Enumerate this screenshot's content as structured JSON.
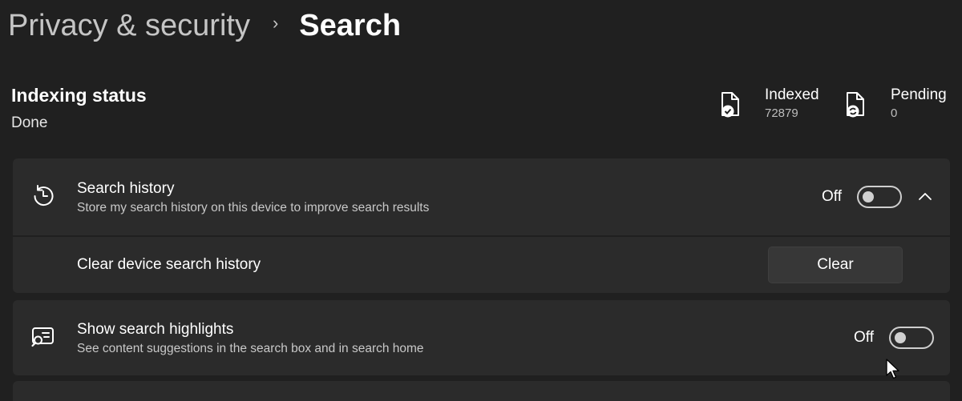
{
  "breadcrumb": {
    "parent": "Privacy & security",
    "separator": "›",
    "current": "Search"
  },
  "indexing": {
    "title": "Indexing status",
    "status": "Done",
    "indexed": {
      "label": "Indexed",
      "value": "72879",
      "icon": "file-check-icon"
    },
    "pending": {
      "label": "Pending",
      "value": "0",
      "icon": "file-sync-icon"
    }
  },
  "search_history": {
    "icon": "history-icon",
    "title": "Search history",
    "description": "Store my search history on this device to improve search results",
    "toggle_label": "Off",
    "toggle_on": false,
    "expanded": true
  },
  "clear_history": {
    "title": "Clear device search history",
    "button_label": "Clear"
  },
  "search_highlights": {
    "icon": "search-highlights-icon",
    "title": "Show search highlights",
    "description": "See content suggestions in the search box and in search home",
    "toggle_label": "Off",
    "toggle_on": false
  },
  "colors": {
    "background": "#202020",
    "card": "#2b2b2b",
    "button": "#373737",
    "text_secondary": "#c8c8c8"
  }
}
